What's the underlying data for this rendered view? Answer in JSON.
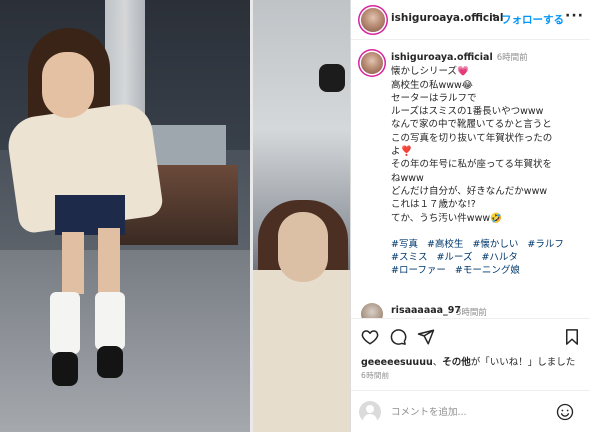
{
  "post": {
    "username": "ishiguroaya.official",
    "follow_label": "フォローする",
    "more_icon": "more-horizontal-icon"
  },
  "caption": {
    "username": "ishiguroaya.official",
    "time": "6時間前",
    "lines": [
      "懐かしシリーズ💗",
      "高校生の私www😂",
      "セーターはラルフで",
      "ルーズはスミスの1番長いやつwww",
      "なんで家の中で靴履いてるかと言うと",
      "この写真を切り抜いて年賀状作ったの",
      "よ❣️",
      "その年の年号に私が座ってる年賀状を",
      "ねwww",
      "どんだけ自分が、好きなんだかwww",
      "これは１７歳かな!?",
      "てか、うち汚い件www🤣"
    ],
    "hashtags": [
      "#写真",
      "#高校生",
      "#懐かしい",
      "#ラルフ",
      "#スミス",
      "#ルーズ",
      "#ハルタ",
      "#ローファー",
      "#モーニング娘"
    ]
  },
  "reply": {
    "username": "risaaaaaa_97",
    "time": "3時間前"
  },
  "actions": {
    "like_icon": "heart-icon",
    "comment_icon": "comment-icon",
    "share_icon": "send-icon",
    "save_icon": "bookmark-icon"
  },
  "likes": {
    "user": "geeeeesuuuu",
    "connector": "、",
    "others": "その他",
    "suffix": "が「いいね！」しました"
  },
  "timestamp": "6時間前",
  "add_comment": {
    "placeholder": "コメントを追加...",
    "emoji_icon": "smiley-icon"
  },
  "colors": {
    "link_blue": "#0095f6",
    "hashtag": "#00376b",
    "muted": "#8e8e8e",
    "text": "#262626"
  }
}
